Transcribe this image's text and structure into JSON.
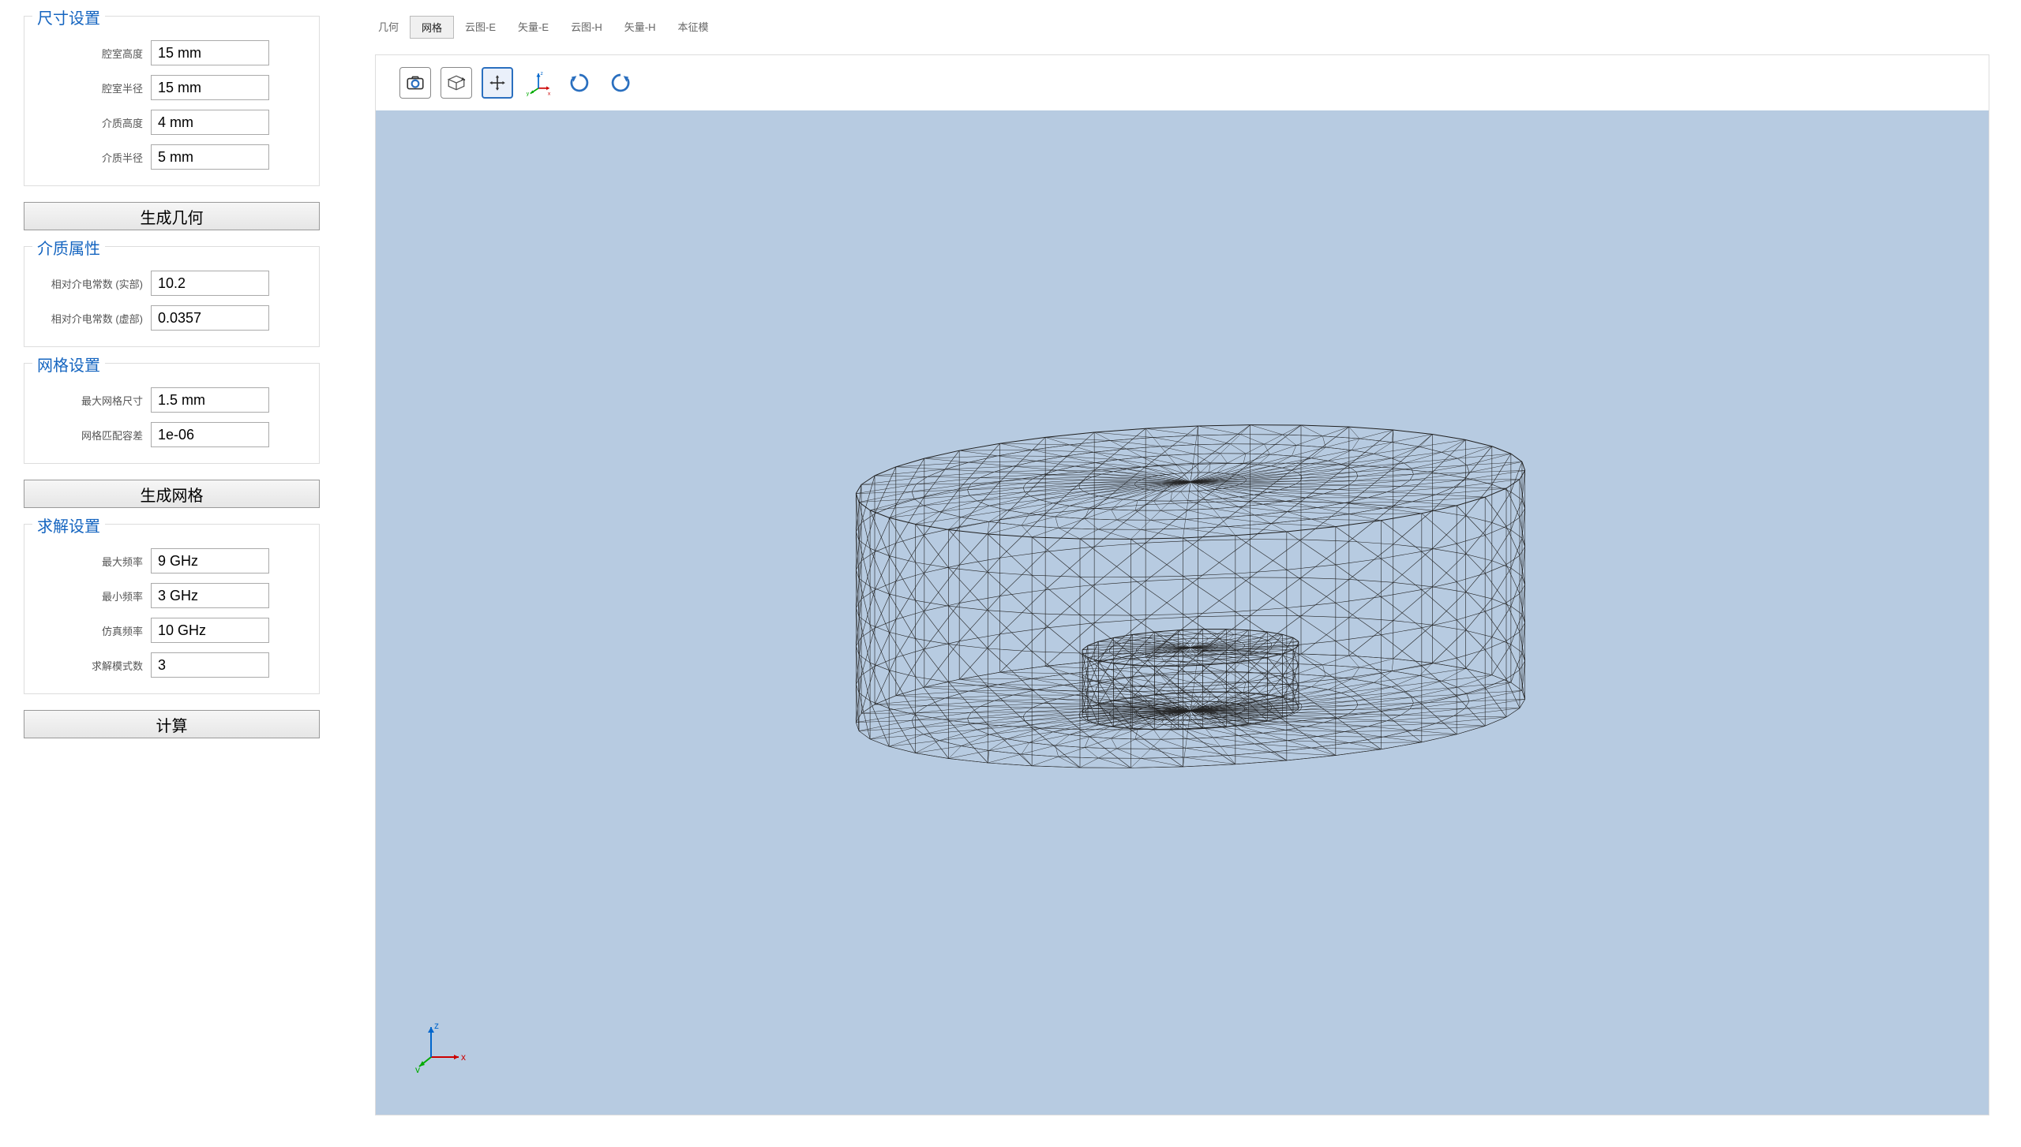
{
  "sidebar": {
    "size_settings": {
      "title": "尺寸设置",
      "fields": {
        "cavity_height": {
          "label": "腔室高度",
          "value": "15 mm"
        },
        "cavity_radius": {
          "label": "腔室半径",
          "value": "15 mm"
        },
        "diel_height": {
          "label": "介质高度",
          "value": "4 mm"
        },
        "diel_radius": {
          "label": "介质半径",
          "value": "5 mm"
        }
      },
      "button": "生成几何"
    },
    "material": {
      "title": "介质属性",
      "fields": {
        "eps_real": {
          "label": "相对介电常数 (实部)",
          "value": "10.2"
        },
        "eps_imag": {
          "label": "相对介电常数 (虚部)",
          "value": "0.0357"
        }
      }
    },
    "mesh": {
      "title": "网格设置",
      "fields": {
        "max_size": {
          "label": "最大网格尺寸",
          "value": "1.5 mm"
        },
        "tolerance": {
          "label": "网格匹配容差",
          "value": "1e-06"
        }
      },
      "button": "生成网格"
    },
    "solver": {
      "title": "求解设置",
      "fields": {
        "fmax": {
          "label": "最大频率",
          "value": "9 GHz"
        },
        "fmin": {
          "label": "最小频率",
          "value": "3 GHz"
        },
        "fsim": {
          "label": "仿真频率",
          "value": "10 GHz"
        },
        "nmode": {
          "label": "求解模式数",
          "value": "3"
        }
      },
      "button": "计算"
    }
  },
  "tabs": {
    "items": [
      {
        "label": "几何",
        "active": false
      },
      {
        "label": "网格",
        "active": true
      },
      {
        "label": "云图-E",
        "active": false
      },
      {
        "label": "矢量-E",
        "active": false
      },
      {
        "label": "云图-H",
        "active": false
      },
      {
        "label": "矢量-H",
        "active": false
      },
      {
        "label": "本征模",
        "active": false
      }
    ]
  },
  "axes": {
    "x": "x",
    "y": "y",
    "z": "z"
  }
}
